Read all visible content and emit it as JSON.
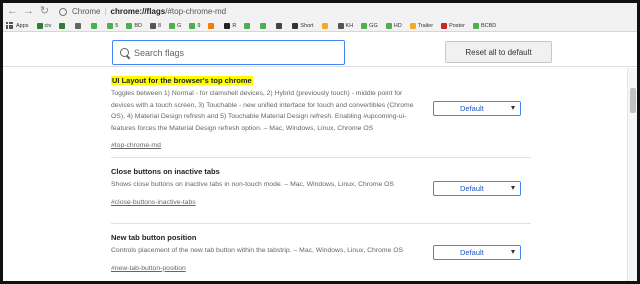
{
  "toolbar": {
    "back_icon": "←",
    "forward_icon": "→",
    "reload_icon": "↻",
    "chrome_label": "Chrome",
    "separator": "|",
    "url_host": "chrome://flags",
    "url_rest": "/#top-chrome-md"
  },
  "bookmarks": {
    "apps_label": "Apps",
    "items": [
      {
        "label": "civ",
        "color": "#2e7d32"
      },
      {
        "label": "",
        "color": "#2e7d32"
      },
      {
        "label": "",
        "color": "#666666"
      },
      {
        "label": "",
        "color": "#4caf50"
      },
      {
        "label": "5",
        "color": "#4caf50"
      },
      {
        "label": "BD",
        "color": "#4caf50"
      },
      {
        "label": "8",
        "color": "#555555"
      },
      {
        "label": "G",
        "color": "#4caf50"
      },
      {
        "label": "9",
        "color": "#4caf50"
      },
      {
        "label": "",
        "color": "#f57c00"
      },
      {
        "label": "R",
        "color": "#222222"
      },
      {
        "label": "",
        "color": "#4caf50"
      },
      {
        "label": "",
        "color": "#4caf50"
      },
      {
        "label": "",
        "color": "#444444"
      },
      {
        "label": "Short",
        "color": "#333333"
      },
      {
        "label": "",
        "color": "#f9a825"
      },
      {
        "label": "KH",
        "color": "#555555"
      },
      {
        "label": "GG",
        "color": "#4caf50"
      },
      {
        "label": "HD",
        "color": "#4caf50"
      },
      {
        "label": "Trailer",
        "color": "#f9a825"
      },
      {
        "label": "Poster",
        "color": "#c62828"
      },
      {
        "label": "BCBD",
        "color": "#4caf50"
      }
    ]
  },
  "search": {
    "placeholder": "Search flags"
  },
  "reset_button": "Reset all to default",
  "experiments": [
    {
      "title": "UI Layout for the browser's top chrome",
      "description": "Toggles between 1) Normal - for clamshell devices, 2) Hybrid (previously touch) - middle point for devices with a touch screen, 3) Touchable - new unified interface for touch and convertibles (Chrome OS), 4) Material Design refresh and 5) Touchable Material Design refresh. Enabling #upcoming-ui-features forces the Material Design refresh option. – Mac, Windows, Linux, Chrome OS",
      "link": "#top-chrome-md",
      "value": "Default"
    },
    {
      "title": "Close buttons on inactive tabs",
      "description": "Shows close buttons on inactive tabs in non-touch mode. – Mac, Windows, Linux, Chrome OS",
      "link": "#close-buttons-inactive-tabs",
      "value": "Default"
    },
    {
      "title": "New tab button position",
      "description": "Controls placement of the new tab button within the tabstrip. – Mac, Windows, Linux, Chrome OS",
      "link": "#new-tab-button-position",
      "value": "Default"
    }
  ],
  "colors": {
    "accent": "#4285f4",
    "highlight": "#ffff00",
    "select_text": "#1a57c9"
  }
}
